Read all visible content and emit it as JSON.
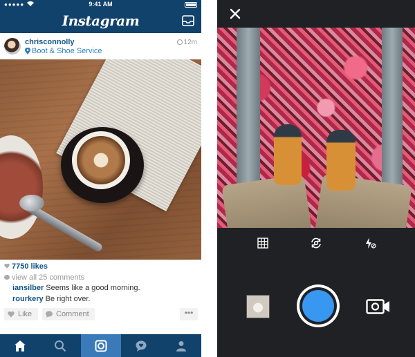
{
  "feed": {
    "status_time": "9:41 AM",
    "app_title": "Instagram",
    "post": {
      "username": "chrisconnolly",
      "location": "Boot & Shoe Service",
      "time_ago": "12m",
      "likes": "7750 likes",
      "view_comments": "view all 25 comments",
      "comments": [
        {
          "user": "iansilber",
          "text": "Seems like a good morning."
        },
        {
          "user": "rourkery",
          "text": "Be right over."
        }
      ],
      "like_label": "Like",
      "comment_label": "Comment",
      "more_label": "•••"
    },
    "tabs": [
      {
        "icon": "home-icon"
      },
      {
        "icon": "search-icon"
      },
      {
        "icon": "camera-icon",
        "active": true
      },
      {
        "icon": "activity-icon"
      },
      {
        "icon": "profile-icon"
      }
    ]
  },
  "camera": {
    "tools": [
      "grid-icon",
      "flip-camera-icon",
      "flash-off-icon"
    ],
    "shutter_color": "#3897f0"
  },
  "colors": {
    "header_blue": "#11426b",
    "active_tab": "#3a7ab8",
    "link_blue": "#125688",
    "camera_bg": "#1f2125"
  }
}
